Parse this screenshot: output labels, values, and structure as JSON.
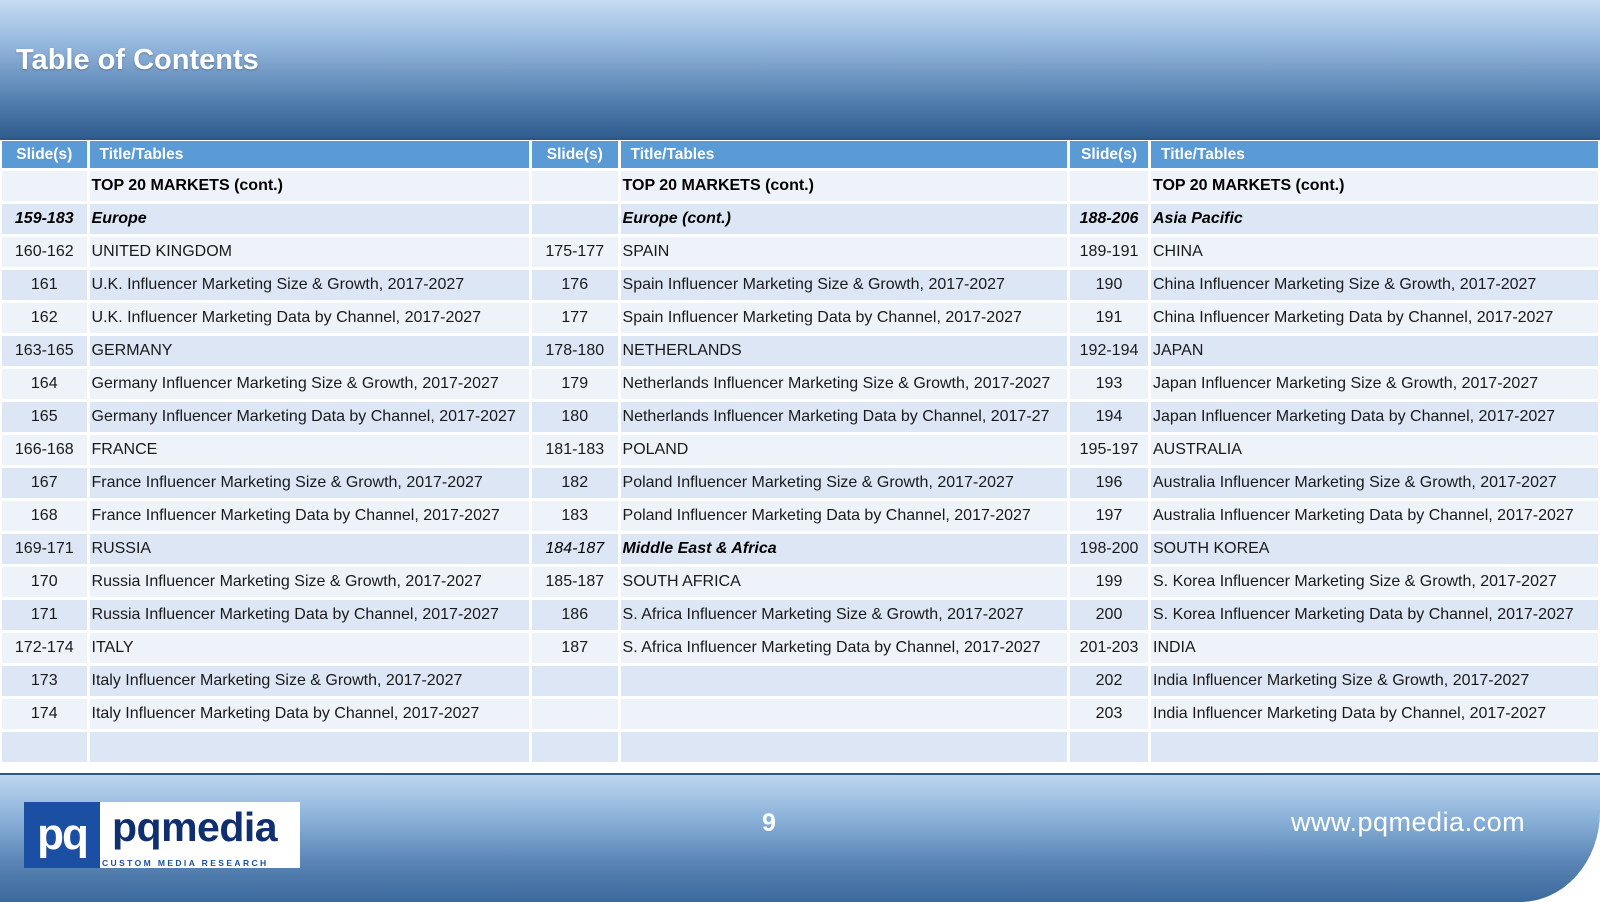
{
  "title": "Table of Contents",
  "headers": {
    "slides": "Slide(s)",
    "titles": "Title/Tables"
  },
  "columns": [
    {
      "rows": [
        {
          "slides": "",
          "title": "TOP 20 MARKETS (cont.)",
          "kind": "top"
        },
        {
          "slides": "159-183",
          "title": "Europe",
          "kind": "region"
        },
        {
          "slides": "160-162",
          "title": "UNITED KINGDOM",
          "kind": "item"
        },
        {
          "slides": "161",
          "title": "U.K. Influencer Marketing Size & Growth, 2017-2027",
          "kind": "item"
        },
        {
          "slides": "162",
          "title": "U.K. Influencer Marketing Data by Channel, 2017-2027",
          "kind": "item"
        },
        {
          "slides": "163-165",
          "title": "GERMANY",
          "kind": "item"
        },
        {
          "slides": "164",
          "title": "Germany Influencer Marketing Size & Growth, 2017-2027",
          "kind": "item"
        },
        {
          "slides": "165",
          "title": "Germany Influencer Marketing Data by Channel, 2017-2027",
          "kind": "item"
        },
        {
          "slides": "166-168",
          "title": "FRANCE",
          "kind": "item"
        },
        {
          "slides": "167",
          "title": "France Influencer Marketing Size & Growth, 2017-2027",
          "kind": "item"
        },
        {
          "slides": "168",
          "title": "France Influencer Marketing Data by Channel, 2017-2027",
          "kind": "item"
        },
        {
          "slides": "169-171",
          "title": "RUSSIA",
          "kind": "item"
        },
        {
          "slides": "170",
          "title": "Russia Influencer Marketing Size & Growth, 2017-2027",
          "kind": "item"
        },
        {
          "slides": "171",
          "title": "Russia Influencer Marketing Data by Channel, 2017-2027",
          "kind": "item"
        },
        {
          "slides": "172-174",
          "title": "ITALY",
          "kind": "item"
        },
        {
          "slides": "173",
          "title": "Italy Influencer Marketing Size & Growth, 2017-2027",
          "kind": "item"
        },
        {
          "slides": "174",
          "title": "Italy Influencer Marketing Data by Channel, 2017-2027",
          "kind": "item"
        },
        {
          "slides": "",
          "title": "",
          "kind": "item"
        }
      ]
    },
    {
      "rows": [
        {
          "slides": "",
          "title": "TOP 20 MARKETS (cont.)",
          "kind": "top"
        },
        {
          "slides": "",
          "title": "Europe (cont.)",
          "kind": "region"
        },
        {
          "slides": "175-177",
          "title": "SPAIN",
          "kind": "item"
        },
        {
          "slides": "176",
          "title": "Spain Influencer Marketing Size & Growth, 2017-2027",
          "kind": "item"
        },
        {
          "slides": "177",
          "title": "Spain Influencer Marketing Data by Channel, 2017-2027",
          "kind": "item"
        },
        {
          "slides": "178-180",
          "title": "NETHERLANDS",
          "kind": "item"
        },
        {
          "slides": "179",
          "title": "Netherlands Influencer Marketing Size & Growth, 2017-2027",
          "kind": "item"
        },
        {
          "slides": "180",
          "title": "Netherlands Influencer Marketing Data by Channel, 2017-27",
          "kind": "item"
        },
        {
          "slides": "181-183",
          "title": "POLAND",
          "kind": "item"
        },
        {
          "slides": "182",
          "title": "Poland Influencer Marketing Size & Growth, 2017-2027",
          "kind": "item"
        },
        {
          "slides": "183",
          "title": "Poland Influencer Marketing Data by Channel, 2017-2027",
          "kind": "item"
        },
        {
          "slides": "184-187",
          "title": "Middle East & Africa",
          "kind": "regionlite"
        },
        {
          "slides": "185-187",
          "title": "SOUTH AFRICA",
          "kind": "item"
        },
        {
          "slides": "186",
          "title": "S. Africa Influencer Marketing Size & Growth, 2017-2027",
          "kind": "item"
        },
        {
          "slides": "187",
          "title": "S. Africa Influencer Marketing Data by Channel, 2017-2027",
          "kind": "item"
        },
        {
          "slides": "",
          "title": "",
          "kind": "item"
        },
        {
          "slides": "",
          "title": "",
          "kind": "item"
        },
        {
          "slides": "",
          "title": "",
          "kind": "item"
        }
      ]
    },
    {
      "rows": [
        {
          "slides": "",
          "title": "TOP 20 MARKETS (cont.)",
          "kind": "top"
        },
        {
          "slides": "188-206",
          "title": "Asia Pacific",
          "kind": "region"
        },
        {
          "slides": "189-191",
          "title": "CHINA",
          "kind": "item"
        },
        {
          "slides": "190",
          "title": "China Influencer Marketing Size & Growth, 2017-2027",
          "kind": "item"
        },
        {
          "slides": "191",
          "title": "China Influencer Marketing Data by Channel, 2017-2027",
          "kind": "item"
        },
        {
          "slides": "192-194",
          "title": "JAPAN",
          "kind": "item"
        },
        {
          "slides": "193",
          "title": "Japan Influencer Marketing Size & Growth, 2017-2027",
          "kind": "item"
        },
        {
          "slides": "194",
          "title": "Japan Influencer Marketing Data by Channel, 2017-2027",
          "kind": "item"
        },
        {
          "slides": "195-197",
          "title": "AUSTRALIA",
          "kind": "item"
        },
        {
          "slides": "196",
          "title": "Australia Influencer Marketing Size & Growth, 2017-2027",
          "kind": "item"
        },
        {
          "slides": "197",
          "title": "Australia Influencer Marketing Data by Channel, 2017-2027",
          "kind": "item"
        },
        {
          "slides": "198-200",
          "title": "SOUTH KOREA",
          "kind": "item"
        },
        {
          "slides": "199",
          "title": "S. Korea Influencer Marketing Size & Growth, 2017-2027",
          "kind": "item"
        },
        {
          "slides": "200",
          "title": "S. Korea Influencer Marketing Data by Channel, 2017-2027",
          "kind": "item"
        },
        {
          "slides": "201-203",
          "title": "INDIA",
          "kind": "item"
        },
        {
          "slides": "202",
          "title": "India Influencer Marketing Size & Growth, 2017-2027",
          "kind": "item"
        },
        {
          "slides": "203",
          "title": "India Influencer Marketing Data by Channel, 2017-2027",
          "kind": "item"
        },
        {
          "slides": "",
          "title": "",
          "kind": "item"
        }
      ]
    }
  ],
  "footer": {
    "logo_mark": "pq",
    "logo_name": "pqmedia",
    "logo_tagline": "CUSTOM MEDIA RESEARCH",
    "page_number": "9",
    "website": "www.pqmedia.com"
  },
  "colors": {
    "header_cell": "#5b9bd5",
    "row_dark": "#dce6f4",
    "row_light": "#eef3fa",
    "logo_blue": "#1b4fa3"
  }
}
